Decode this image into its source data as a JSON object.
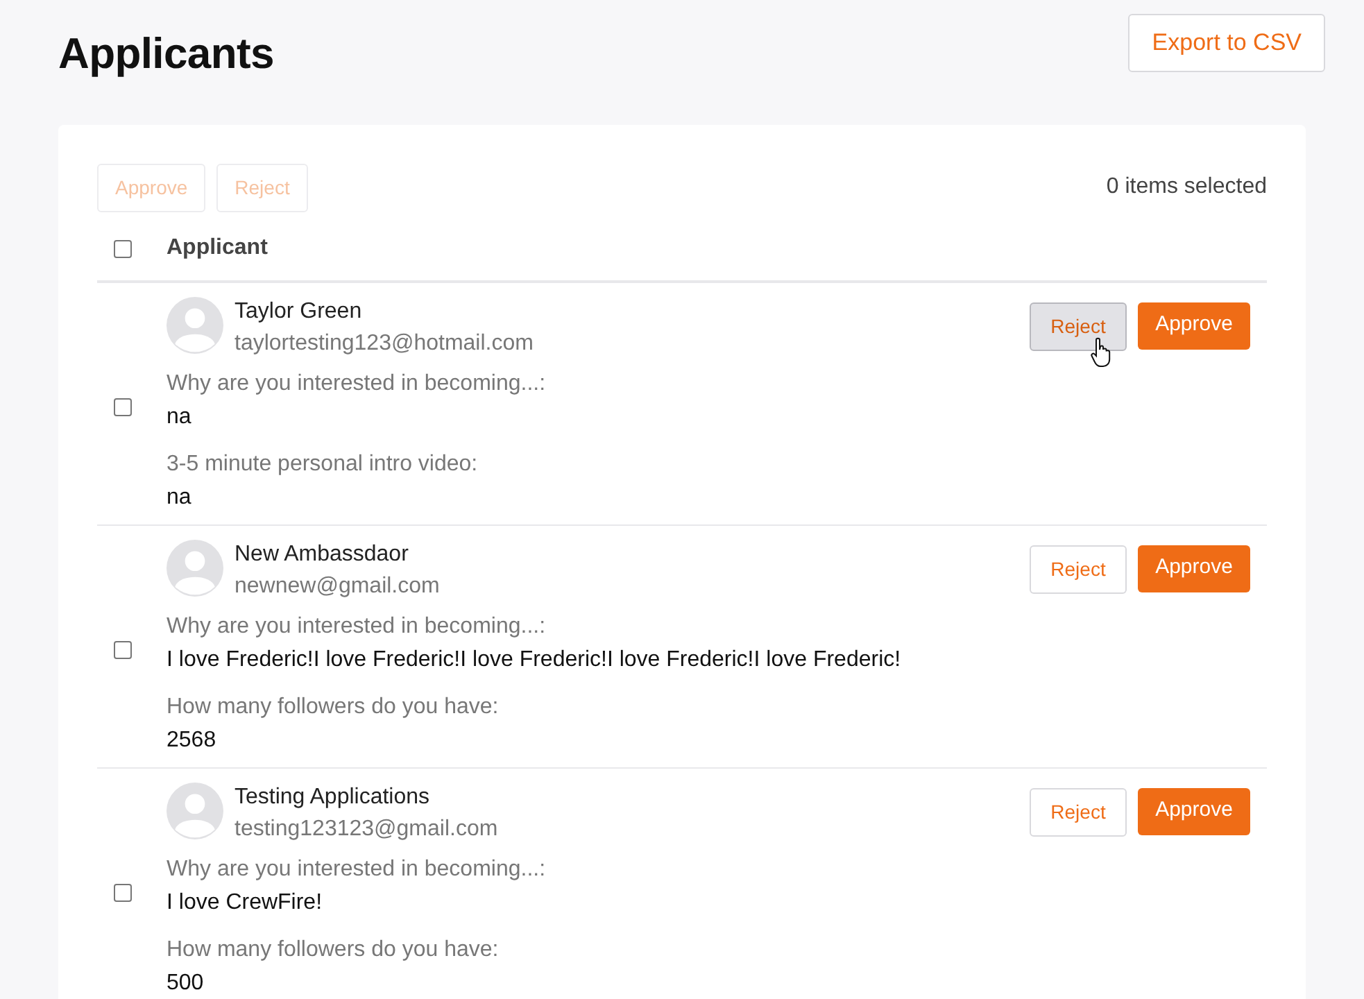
{
  "title": "Applicants",
  "export_button": "Export to CSV",
  "bulk_actions": {
    "buttons": [
      {
        "label": "Approve",
        "disabled": true
      },
      {
        "label": "Reject",
        "disabled": true
      }
    ],
    "selection_count": "0 items selected"
  },
  "table": {
    "select_all_checked": false,
    "column": "Applicant",
    "rows": [
      {
        "checked": false,
        "name": "Taylor Green",
        "email": "taylortesting123@hotmail.com",
        "reject": "Reject",
        "reject_hovered": true,
        "approve": "Approve",
        "answers": [
          {
            "question": "Why are you interested in becoming...:",
            "answer": "na"
          },
          {
            "question": "3-5 minute personal intro video:",
            "answer": "na"
          }
        ]
      },
      {
        "checked": false,
        "name": "New Ambassdaor",
        "email": "newnew@gmail.com",
        "reject": "Reject",
        "reject_hovered": false,
        "approve": "Approve",
        "answers": [
          {
            "question": "Why are you interested in becoming...:",
            "answer": "I love Frederic!I love Frederic!I love Frederic!I love Frederic!I love Frederic!"
          },
          {
            "question": "How many followers do you have:",
            "answer": "2568"
          }
        ]
      },
      {
        "checked": false,
        "name": "Testing Applications",
        "email": "testing123123@gmail.com",
        "reject": "Reject",
        "reject_hovered": false,
        "approve": "Approve",
        "answers": [
          {
            "question": "Why are you interested in becoming...:",
            "answer": "I love CrewFire!"
          },
          {
            "question": "How many followers do you have:",
            "answer": "500"
          }
        ]
      }
    ]
  }
}
